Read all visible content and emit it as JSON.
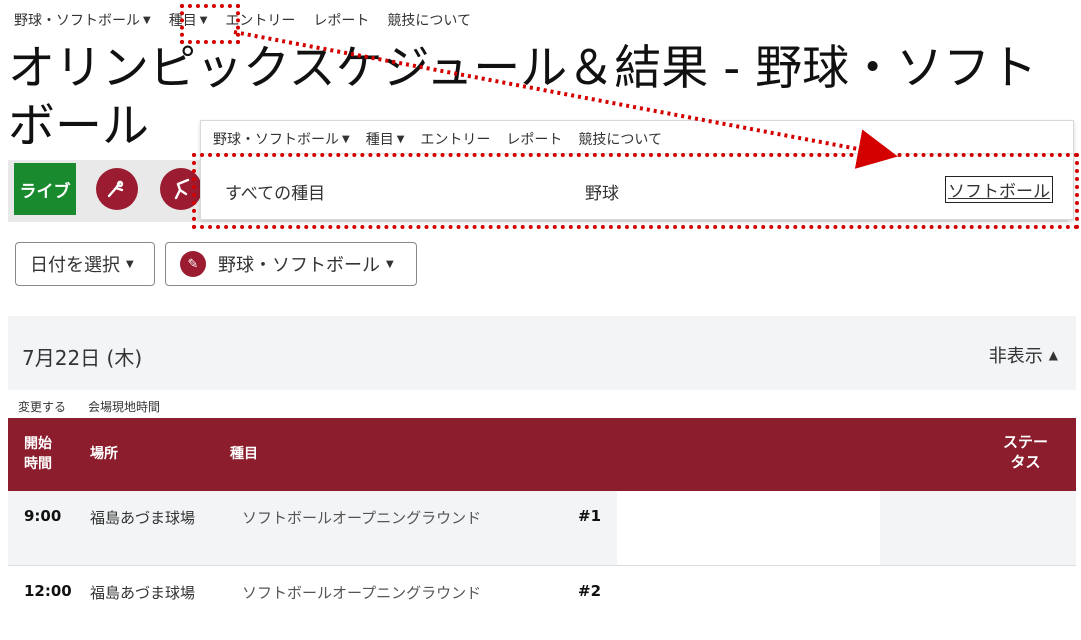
{
  "top_nav": {
    "items": [
      {
        "label": "野球・ソフトボール",
        "caret": true
      },
      {
        "label": "種目",
        "caret": true
      },
      {
        "label": "エントリー",
        "caret": false
      },
      {
        "label": "レポート",
        "caret": false
      },
      {
        "label": "競技について",
        "caret": false
      }
    ]
  },
  "page_title": "オリンピックスケジュール＆結果 - 野球・ソフトボール",
  "live": {
    "label": "ライブ"
  },
  "sport_icons": [
    "softball-player-icon",
    "baseball-batter-icon"
  ],
  "inset": {
    "nav": [
      {
        "label": "野球・ソフトボール",
        "caret": true
      },
      {
        "label": "種目",
        "caret": true
      },
      {
        "label": "エントリー",
        "caret": false
      },
      {
        "label": "レポート",
        "caret": false
      },
      {
        "label": "競技について",
        "caret": false
      }
    ],
    "tabs": [
      "すべての種目",
      "野球",
      "ソフトボール"
    ],
    "active_tab": "ソフトボール"
  },
  "filters": {
    "date_label": "日付を選択",
    "sport_label": "野球・ソフトボール"
  },
  "date_section": {
    "date": "7月22日 (木)",
    "hide_label": "非表示"
  },
  "timezone": {
    "change_label": "変更する",
    "local_time_label": "会場現地時間"
  },
  "table": {
    "headers": {
      "start_time": "開始\n時間",
      "venue": "場所",
      "event": "種目",
      "status": "ステー\nタス"
    },
    "rows": [
      {
        "time": "9:00",
        "venue": "福島あづま球場",
        "event": "ソフトボールオープニングラウンド",
        "number": "#1"
      },
      {
        "time": "12:00",
        "venue": "福島あづま球場",
        "event": "ソフトボールオープニングラウンド",
        "number": "#2"
      }
    ]
  },
  "colors": {
    "accent": "#8b1d2c",
    "live": "#1a8a2e",
    "highlight": "#d40000"
  }
}
